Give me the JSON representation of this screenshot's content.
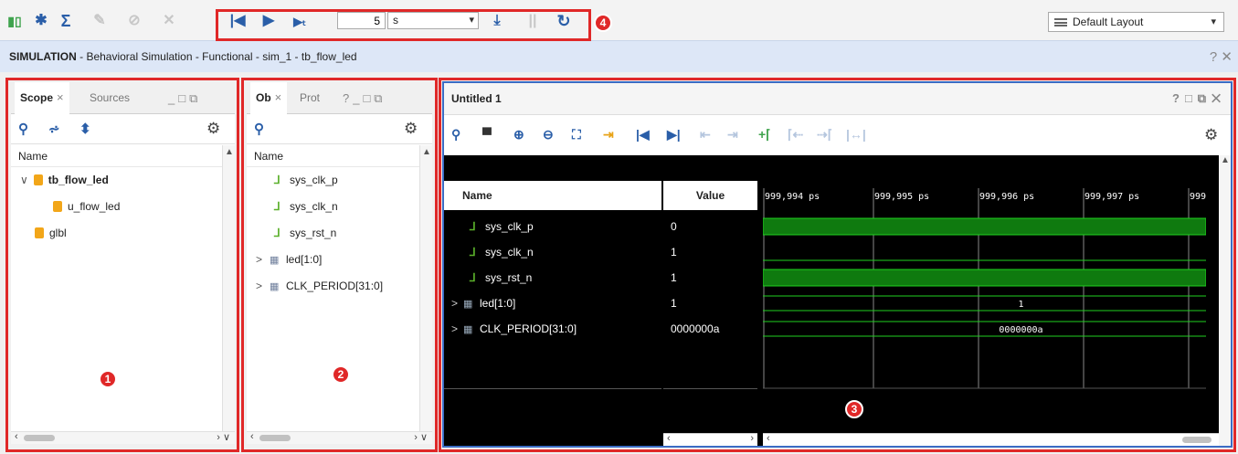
{
  "toolbar": {
    "sim_time_value": "5",
    "sim_time_unit": "s",
    "layout_label": "Default Layout",
    "icons": [
      "run-all-icon",
      "settings-icon",
      "sigma-icon",
      "disabled-icon-1",
      "disabled-icon-2",
      "disabled-icon-3",
      "restart-icon",
      "run-all-play-icon",
      "run-for-time-icon",
      "step-icon",
      "break-icon",
      "relaunch-icon"
    ]
  },
  "header": {
    "bold": "SIMULATION",
    "rest": " - Behavioral Simulation - Functional - sim_1 - tb_flow_led",
    "controls": "? ✕"
  },
  "badges": [
    "1",
    "2",
    "3",
    "4"
  ],
  "scope_panel": {
    "tab_active": "Scope",
    "tab_inactive": "Sources",
    "column": "Name",
    "rows": [
      {
        "label": "tb_flow_led",
        "bold": true,
        "expand": "∨"
      },
      {
        "label": "u_flow_led",
        "bold": false,
        "expand": ""
      },
      {
        "label": "glbl",
        "bold": false,
        "expand": ""
      }
    ]
  },
  "objects_panel": {
    "tab_active": "Ob",
    "tab_inactive": "Prot",
    "column": "Name",
    "rows": [
      {
        "label": "sys_clk_p",
        "kind": "signal",
        "expand": ""
      },
      {
        "label": "sys_clk_n",
        "kind": "signal",
        "expand": ""
      },
      {
        "label": "sys_rst_n",
        "kind": "signal",
        "expand": ""
      },
      {
        "label": "led[1:0]",
        "kind": "bus",
        "expand": ">"
      },
      {
        "label": "CLK_PERIOD[31:0]",
        "kind": "bus",
        "expand": ">"
      }
    ]
  },
  "wave_panel": {
    "title": "Untitled 1",
    "name_header": "Name",
    "value_header": "Value",
    "rows": [
      {
        "name": "sys_clk_p",
        "value": "0",
        "kind": "signal",
        "expand": ""
      },
      {
        "name": "sys_clk_n",
        "value": "1",
        "kind": "signal",
        "expand": ""
      },
      {
        "name": "sys_rst_n",
        "value": "1",
        "kind": "signal",
        "expand": ""
      },
      {
        "name": "led[1:0]",
        "value": "1",
        "kind": "bus",
        "expand": ">"
      },
      {
        "name": "CLK_PERIOD[31:0]",
        "value": "0000000a",
        "kind": "bus",
        "expand": ">"
      }
    ],
    "time_labels": [
      "999,994 ps",
      "999,995 ps",
      "999,996 ps",
      "999,997 ps",
      "999,"
    ],
    "bus_labels": [
      "1",
      "0000000a"
    ],
    "wave_color": "#1fd11f",
    "wave_fill": "#0f7a0f"
  },
  "colors": {
    "highlight_box": "#e02828",
    "wave_border": "#3b6cc4",
    "header_bg": "#dde7f7"
  }
}
